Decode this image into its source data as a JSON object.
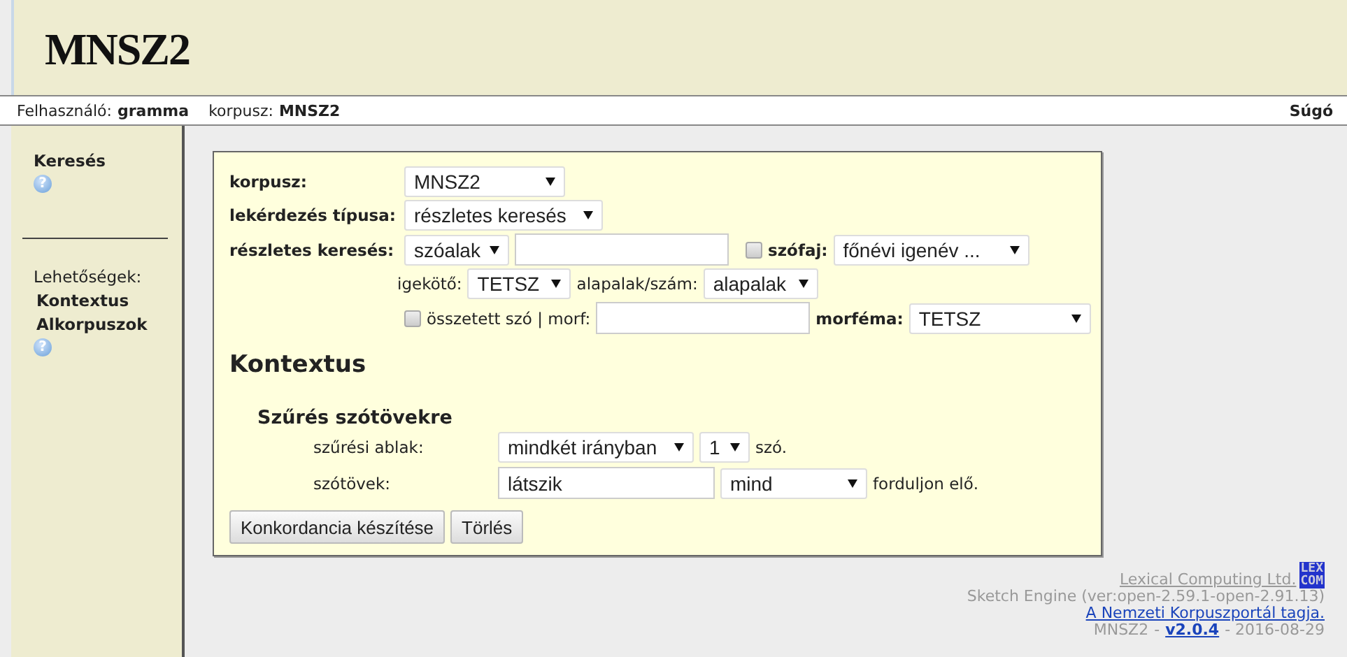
{
  "logo": "MNSZ2",
  "topbar": {
    "user_label": "Felhasználó:",
    "user": "gramma",
    "corpus_label": "korpusz:",
    "corpus": "MNSZ2",
    "help": "Súgó"
  },
  "sidebar": {
    "search": "Keresés",
    "search_help": "?",
    "options_label": "Lehetőségek:",
    "items": [
      {
        "label": "Kontextus"
      },
      {
        "label": "Alkorpuszok"
      }
    ],
    "options_help": "?"
  },
  "form": {
    "corpus_label": "korpusz:",
    "corpus": "MNSZ2",
    "query_type_label": "lekérdezés típusa:",
    "query_type": "részletes keresés",
    "detailed_label": "részletes keresés:",
    "attribute": "szóalak",
    "pos_checked": false,
    "pos_label": "szófaj:",
    "pos": "főnévi igenév ...",
    "preverb_label": "igekötő:",
    "preverb": "TETSZ",
    "lemma_label": "alapalak/szám:",
    "lemma": "alapalak",
    "compound_checked": false,
    "compound_label": "összetett szó | morf:",
    "morpheme_label": "morféma:",
    "morpheme": "TETSZ"
  },
  "context": {
    "title": "Kontextus",
    "subtitle": "Szűrés szótövekre",
    "window_label": "szűrési ablak:",
    "direction": "mindkét irányban",
    "count": "1",
    "unit": "szó.",
    "lemmas_label": "szótövek:",
    "lemmas": "látszik",
    "quantifier": "mind",
    "suffix": "forduljon elő."
  },
  "buttons": [
    "Konkordancia készítése",
    "Törlés"
  ],
  "footer": {
    "company": "Lexical Computing Ltd.",
    "logo_lines": [
      "LEX",
      "COM"
    ],
    "engine": "Sketch Engine (ver:open-2.59.1-open-2.91.13)",
    "portal": "A Nemzeti Korpuszportál tagja.",
    "corpus": "MNSZ2",
    "separator": "-",
    "version": "v2.0.4",
    "date": "- 2016-08-29"
  }
}
